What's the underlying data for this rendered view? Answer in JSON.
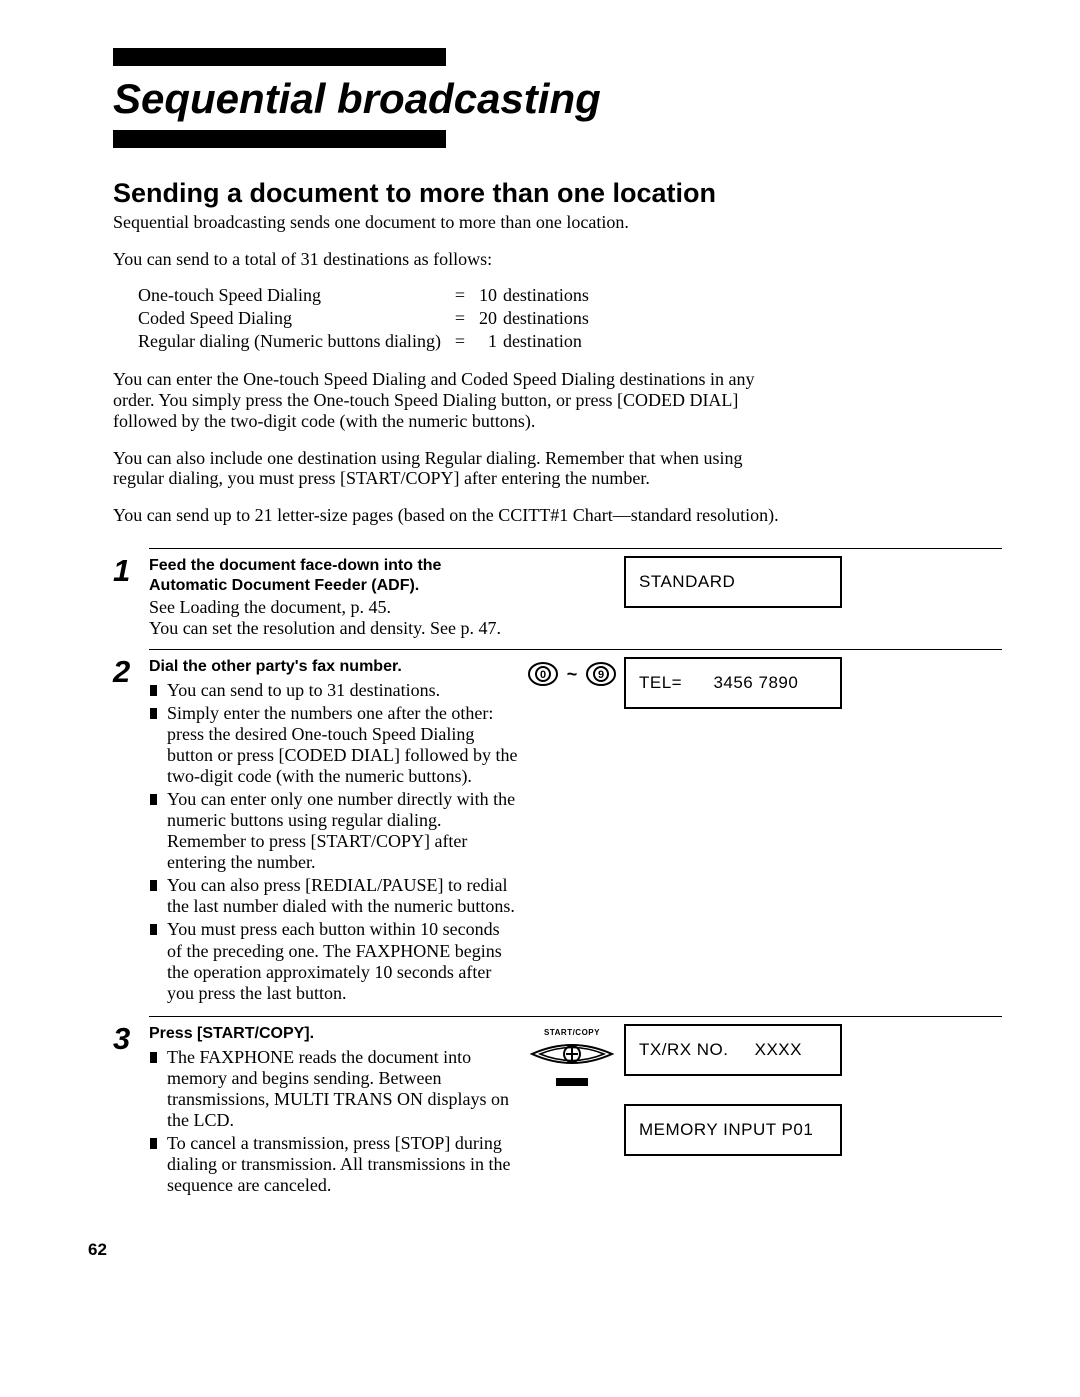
{
  "header": {
    "title": "Sequential broadcasting",
    "subtitle": "Sending a document to more than one location",
    "intro": "Sequential broadcasting sends one document to more than one location.",
    "para1": "You can send to a total of 31 destinations as follows:",
    "dest": [
      {
        "label": "One-touch Speed Dialing",
        "eq": "=",
        "val": "10",
        "unit": "destinations"
      },
      {
        "label": "Coded Speed Dialing",
        "eq": "=",
        "val": "20",
        "unit": "destinations"
      },
      {
        "label": "Regular dialing (Numeric buttons dialing)",
        "eq": "=",
        "val": "1",
        "unit": "destination"
      }
    ],
    "para2": "You can enter the One-touch Speed Dialing and Coded Speed Dialing destinations in any order. You simply press the One-touch Speed Dialing button, or press [CODED DIAL] followed by the two-digit code (with the numeric buttons).",
    "para3": "You can also include one destination using Regular dialing. Remember that when using regular dialing, you must press [START/COPY] after entering the number.",
    "para4": "You can send up to 21 letter-size pages (based on the CCITT#1 Chart—standard resolution)."
  },
  "steps": {
    "s1": {
      "num": "1",
      "bold": "Feed the document face-down into the Automatic Document Feeder (ADF).",
      "lines": [
        "See Loading the document, p. 45.",
        "You can set the resolution and density. See p. 47."
      ],
      "lcd": "STANDARD"
    },
    "s2": {
      "num": "2",
      "bold": "Dial the other party's fax number.",
      "bullets": [
        "You can send to up to 31 destinations.",
        "Simply enter the numbers one after the other: press the desired One-touch Speed Dialing button or press [CODED DIAL] followed by the two-digit code (with the numeric buttons).",
        "You can enter only one number directly with the numeric buttons using regular dialing. Remember to press [START/COPY] after entering the number.",
        "You can also press [REDIAL/PAUSE] to redial the last number dialed with the numeric buttons.",
        "You must press each button within 10 seconds of the preceding one. The FAXPHONE begins the operation approximately 10 seconds after you press the last button."
      ],
      "lcd": "TEL=      3456 7890"
    },
    "s3": {
      "num": "3",
      "bold": "Press [START/COPY].",
      "bullets": [
        "The FAXPHONE reads the document into memory and begins sending. Between transmissions, MULTI TRANS ON displays on the LCD.",
        "To cancel a transmission, press [STOP] during dialing or transmission. All transmissions in the sequence are canceled."
      ],
      "lcd1": "TX/RX NO.     XXXX",
      "lcd2": "MEMORY INPUT P01"
    }
  },
  "page_number": "62"
}
